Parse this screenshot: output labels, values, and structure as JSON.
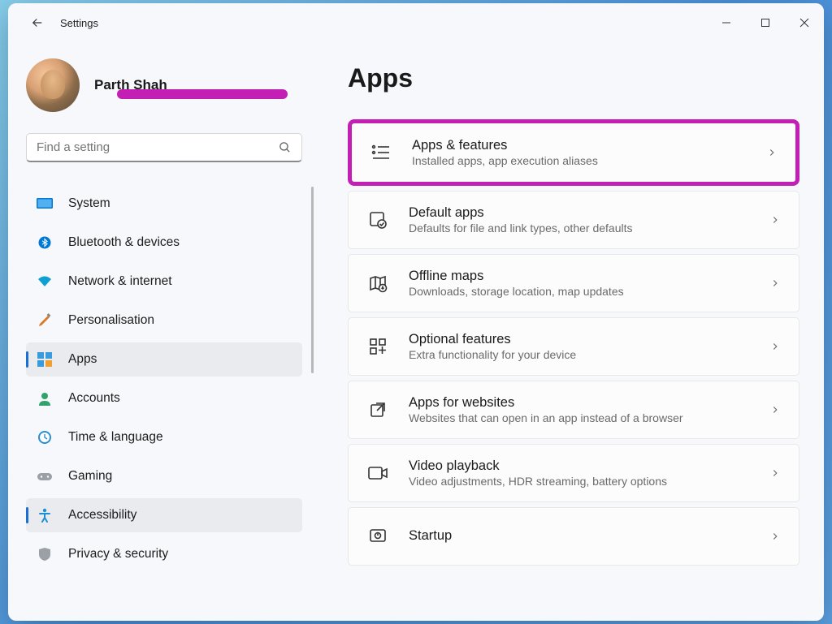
{
  "window": {
    "title": "Settings"
  },
  "profile": {
    "name": "Parth Shah"
  },
  "search": {
    "placeholder": "Find a setting"
  },
  "sidebar": {
    "items": [
      {
        "label": "System"
      },
      {
        "label": "Bluetooth & devices"
      },
      {
        "label": "Network & internet"
      },
      {
        "label": "Personalisation"
      },
      {
        "label": "Apps"
      },
      {
        "label": "Accounts"
      },
      {
        "label": "Time & language"
      },
      {
        "label": "Gaming"
      },
      {
        "label": "Accessibility"
      },
      {
        "label": "Privacy & security"
      }
    ]
  },
  "main": {
    "page_title": "Apps",
    "cards": [
      {
        "title": "Apps & features",
        "sub": "Installed apps, app execution aliases"
      },
      {
        "title": "Default apps",
        "sub": "Defaults for file and link types, other defaults"
      },
      {
        "title": "Offline maps",
        "sub": "Downloads, storage location, map updates"
      },
      {
        "title": "Optional features",
        "sub": "Extra functionality for your device"
      },
      {
        "title": "Apps for websites",
        "sub": "Websites that can open in an app instead of a browser"
      },
      {
        "title": "Video playback",
        "sub": "Video adjustments, HDR streaming, battery options"
      },
      {
        "title": "Startup",
        "sub": ""
      }
    ]
  },
  "highlight_color": "#c41fb5"
}
